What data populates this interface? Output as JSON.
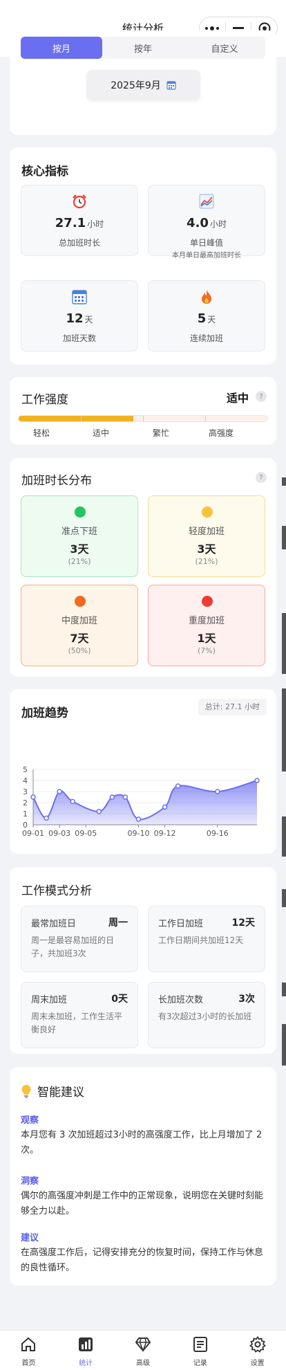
{
  "header": {
    "title": "统计分析"
  },
  "period_tabs": [
    "按月",
    "按年",
    "自定义"
  ],
  "period": {
    "selected": "2025年9月"
  },
  "core": {
    "title": "核心指标",
    "metrics": [
      {
        "icon": "alarm-clock-icon",
        "value": "27.1",
        "unit": "小时",
        "label": "总加班时长",
        "sub": ""
      },
      {
        "icon": "trend-chart-icon",
        "value": "4.0",
        "unit": "小时",
        "label": "单日峰值",
        "sub": "本月单日最高加班时长"
      },
      {
        "icon": "calendar-icon",
        "value": "12",
        "unit": "天",
        "label": "加班天数",
        "sub": ""
      },
      {
        "icon": "fire-icon",
        "value": "5",
        "unit": "天",
        "label": "连续加班",
        "sub": ""
      }
    ]
  },
  "intensity": {
    "title": "工作强度",
    "level": "适中",
    "help": "?",
    "fill_fraction": 0.46,
    "scale": [
      "轻松",
      "适中",
      "繁忙",
      "高强度"
    ]
  },
  "distribution": {
    "title": "加班时长分布",
    "help": "?",
    "items": [
      {
        "name": "准点下班",
        "days": "3天",
        "pct": "(21%)",
        "dot": "#22c55e",
        "bg": "#edfbf1",
        "border": "#a9e7bd"
      },
      {
        "name": "轻度加班",
        "days": "3天",
        "pct": "(21%)",
        "dot": "#f5c33b",
        "bg": "#fefaec",
        "border": "#f3dd95"
      },
      {
        "name": "中度加班",
        "days": "7天",
        "pct": "(50%)",
        "dot": "#f26b21",
        "bg": "#fff4e8",
        "border": "#f5b57a"
      },
      {
        "name": "重度加班",
        "days": "1天",
        "pct": "(7%)",
        "dot": "#ef3b33",
        "bg": "#fef0ef",
        "border": "#f3a9a4"
      }
    ]
  },
  "trend": {
    "title": "加班趋势",
    "total": "总计: 27.1 小时"
  },
  "chart_data": {
    "type": "area",
    "x": [
      "09-01",
      "09-02",
      "09-03",
      "09-04",
      "09-05",
      "09-06",
      "09-07",
      "09-08",
      "09-09",
      "09-10",
      "09-11",
      "09-12",
      "09-13",
      "09-14",
      "09-15",
      "09-16",
      "09-17",
      "09-18"
    ],
    "values": [
      2.5,
      0.6,
      3.0,
      2.1,
      1.2,
      2.5,
      2.5,
      0.5,
      1.6,
      3.5,
      3.0,
      4.0
    ],
    "value_x_index": [
      0,
      1,
      2,
      3,
      5,
      6,
      7,
      8,
      10,
      11,
      14,
      17
    ],
    "xtick_labels": [
      "09-01",
      "09-03",
      "09-05",
      "09-10",
      "09-12",
      "09-16"
    ],
    "xtick_index": [
      0,
      2,
      4,
      8,
      10,
      14
    ],
    "yticks": [
      0,
      1,
      2,
      3,
      4,
      5
    ],
    "ylim": [
      0,
      5
    ],
    "color": "#6a6ef0",
    "grid": true
  },
  "pattern": {
    "title": "工作模式分析",
    "items": [
      {
        "head": "最常加班日",
        "value": "周一",
        "desc": "周一是最容易加班的日子，共加班3次"
      },
      {
        "head": "工作日加班",
        "value": "12天",
        "desc": "工作日期间共加班12天"
      },
      {
        "head": "周末加班",
        "value": "0天",
        "desc": "周末未加班，工作生活平衡良好"
      },
      {
        "head": "长加班次数",
        "value": "3次",
        "desc": "有3次超过3小时的长加班"
      }
    ]
  },
  "suggestions": {
    "title": "智能建议",
    "blocks": [
      {
        "label": "观察",
        "text": "本月您有 3 次加班超过3小时的高强度工作，比上月增加了 2 次。"
      },
      {
        "label": "洞察",
        "text": "偶尔的高强度冲刺是工作中的正常现象，说明您在关键时刻能够全力以赴。"
      },
      {
        "label": "建议",
        "text": "在高强度工作后，记得安排充分的恢复时间，保持工作与休息的良性循环。"
      }
    ]
  },
  "tabbar": {
    "items": [
      {
        "label": "首页",
        "icon": "home-icon"
      },
      {
        "label": "统计",
        "icon": "stats-icon"
      },
      {
        "label": "高级",
        "icon": "diamond-icon"
      },
      {
        "label": "记录",
        "icon": "records-icon"
      },
      {
        "label": "设置",
        "icon": "settings-icon"
      }
    ],
    "active": "统计"
  },
  "colors": {
    "accent": "#6a6ef0",
    "intensity_fill": "#f2b21e"
  }
}
